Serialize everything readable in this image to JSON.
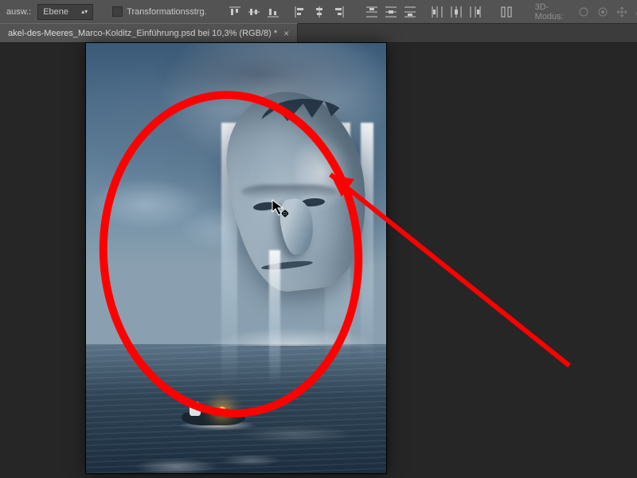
{
  "options_bar": {
    "ausw_label": "ausw.:",
    "layer_select": {
      "value": "Ebene"
    },
    "transform_controls_label": "Transformationsstrg.",
    "mode3d_label": "3D-Modus:"
  },
  "document_tab": {
    "title": "akel-des-Meeres_Marco-Kolditz_Einführung.psd bei 10,3% (RGB/8) *"
  },
  "annotation": {
    "stroke": "#ff0000",
    "ellipse": {
      "stroke_width": 10
    },
    "arrow": {
      "stroke_width": 6
    }
  },
  "artwork": {
    "description": "Giant stone face emerging from sea with waterfalls, stormy sky, small rowboat with lantern and figure",
    "palette": {
      "sky_top": "#3a5a78",
      "sky_mid": "#7592a8",
      "sea_dark": "#1b2d3e",
      "stone_light": "#aebecb",
      "stone_dark": "#7c93a4",
      "lantern": "#ffb030"
    }
  },
  "canvas": {
    "zoom_percent": 10.3,
    "color_mode": "RGB/8"
  }
}
